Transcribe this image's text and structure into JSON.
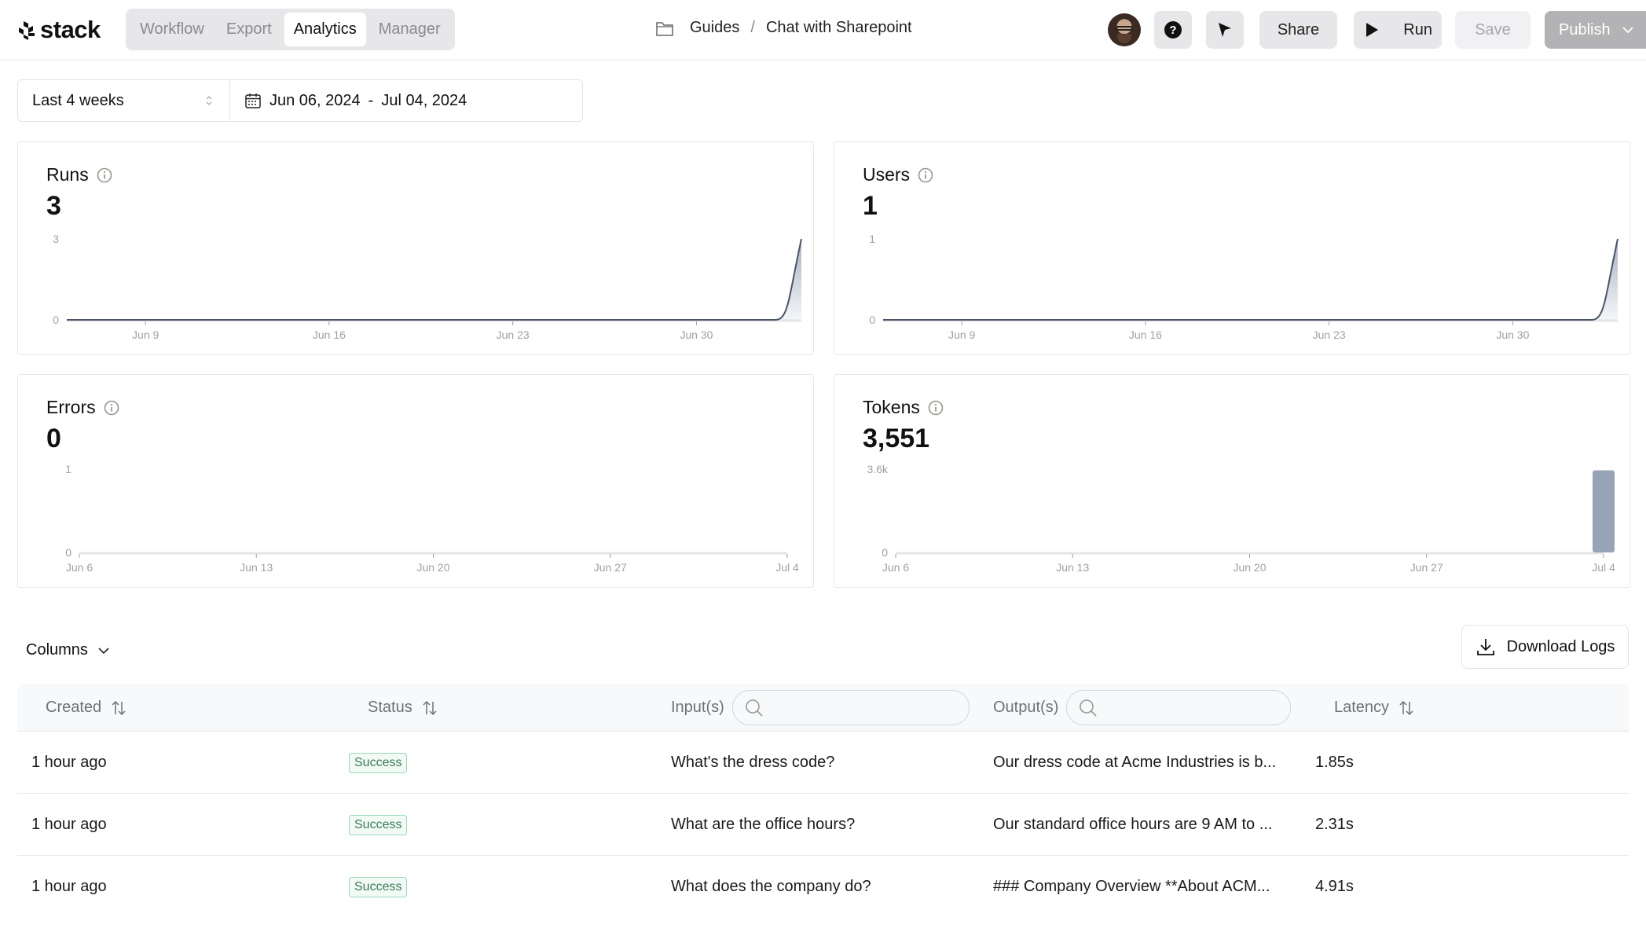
{
  "app": {
    "logo_text": "stack",
    "tabs": [
      {
        "label": "Workflow",
        "active": false
      },
      {
        "label": "Export",
        "active": false
      },
      {
        "label": "Analytics",
        "active": true
      },
      {
        "label": "Manager",
        "active": false
      }
    ],
    "breadcrumb": {
      "icon": "folder-icon",
      "parent": "Guides",
      "separator": "/",
      "current": "Chat with Sharepoint"
    },
    "toolbar": {
      "help_icon": "question-circle-icon",
      "pointer_icon": "cursor-arrow-icon",
      "share_label": "Share",
      "run_label": "Run",
      "save_label": "Save",
      "publish_label": "Publish"
    }
  },
  "filters": {
    "range_label": "Last 4 weeks",
    "date_start": "Jun 06, 2024",
    "date_sep": "-",
    "date_end": "Jul 04, 2024"
  },
  "metrics": {
    "runs": {
      "title": "Runs",
      "value": "3"
    },
    "users": {
      "title": "Users",
      "value": "1"
    },
    "errors": {
      "title": "Errors",
      "value": "0"
    },
    "tokens": {
      "title": "Tokens",
      "value": "3,551"
    }
  },
  "chart_data": [
    {
      "id": "runs",
      "type": "area",
      "title": "Runs",
      "x": [
        "Jun 6",
        "Jun 7",
        "Jun 8",
        "Jun 9",
        "Jun 10",
        "Jun 11",
        "Jun 12",
        "Jun 13",
        "Jun 14",
        "Jun 15",
        "Jun 16",
        "Jun 17",
        "Jun 18",
        "Jun 19",
        "Jun 20",
        "Jun 21",
        "Jun 22",
        "Jun 23",
        "Jun 24",
        "Jun 25",
        "Jun 26",
        "Jun 27",
        "Jun 28",
        "Jun 29",
        "Jun 30",
        "Jul 1",
        "Jul 2",
        "Jul 3",
        "Jul 4"
      ],
      "values": [
        0,
        0,
        0,
        0,
        0,
        0,
        0,
        0,
        0,
        0,
        0,
        0,
        0,
        0,
        0,
        0,
        0,
        0,
        0,
        0,
        0,
        0,
        0,
        0,
        0,
        0,
        0,
        0,
        3
      ],
      "ylim": [
        0,
        3
      ],
      "y_ticks": [
        "0",
        "3"
      ],
      "x_ticks": [
        "Jun 9",
        "Jun 16",
        "Jun 23",
        "Jun 30"
      ],
      "grid": false
    },
    {
      "id": "users",
      "type": "area",
      "title": "Users",
      "x": [
        "Jun 6",
        "Jun 7",
        "Jun 8",
        "Jun 9",
        "Jun 10",
        "Jun 11",
        "Jun 12",
        "Jun 13",
        "Jun 14",
        "Jun 15",
        "Jun 16",
        "Jun 17",
        "Jun 18",
        "Jun 19",
        "Jun 20",
        "Jun 21",
        "Jun 22",
        "Jun 23",
        "Jun 24",
        "Jun 25",
        "Jun 26",
        "Jun 27",
        "Jun 28",
        "Jun 29",
        "Jun 30",
        "Jul 1",
        "Jul 2",
        "Jul 3",
        "Jul 4"
      ],
      "values": [
        0,
        0,
        0,
        0,
        0,
        0,
        0,
        0,
        0,
        0,
        0,
        0,
        0,
        0,
        0,
        0,
        0,
        0,
        0,
        0,
        0,
        0,
        0,
        0,
        0,
        0,
        0,
        0,
        1
      ],
      "ylim": [
        0,
        1
      ],
      "y_ticks": [
        "0",
        "1"
      ],
      "x_ticks": [
        "Jun 9",
        "Jun 16",
        "Jun 23",
        "Jun 30"
      ],
      "grid": false
    },
    {
      "id": "errors",
      "type": "bar",
      "title": "Errors",
      "x": [
        "Jun 6",
        "Jun 7",
        "Jun 8",
        "Jun 9",
        "Jun 10",
        "Jun 11",
        "Jun 12",
        "Jun 13",
        "Jun 14",
        "Jun 15",
        "Jun 16",
        "Jun 17",
        "Jun 18",
        "Jun 19",
        "Jun 20",
        "Jun 21",
        "Jun 22",
        "Jun 23",
        "Jun 24",
        "Jun 25",
        "Jun 26",
        "Jun 27",
        "Jun 28",
        "Jun 29",
        "Jun 30",
        "Jul 1",
        "Jul 2",
        "Jul 3",
        "Jul 4"
      ],
      "values": [
        0,
        0,
        0,
        0,
        0,
        0,
        0,
        0,
        0,
        0,
        0,
        0,
        0,
        0,
        0,
        0,
        0,
        0,
        0,
        0,
        0,
        0,
        0,
        0,
        0,
        0,
        0,
        0,
        0
      ],
      "ylim": [
        0,
        1
      ],
      "y_ticks": [
        "0",
        "1"
      ],
      "x_ticks": [
        "Jun 6",
        "Jun 13",
        "Jun 20",
        "Jun 27",
        "Jul 4"
      ],
      "grid": false
    },
    {
      "id": "tokens",
      "type": "bar",
      "title": "Tokens",
      "x": [
        "Jun 6",
        "Jun 7",
        "Jun 8",
        "Jun 9",
        "Jun 10",
        "Jun 11",
        "Jun 12",
        "Jun 13",
        "Jun 14",
        "Jun 15",
        "Jun 16",
        "Jun 17",
        "Jun 18",
        "Jun 19",
        "Jun 20",
        "Jun 21",
        "Jun 22",
        "Jun 23",
        "Jun 24",
        "Jun 25",
        "Jun 26",
        "Jun 27",
        "Jun 28",
        "Jun 29",
        "Jun 30",
        "Jul 1",
        "Jul 2",
        "Jul 3",
        "Jul 4"
      ],
      "values": [
        0,
        0,
        0,
        0,
        0,
        0,
        0,
        0,
        0,
        0,
        0,
        0,
        0,
        0,
        0,
        0,
        0,
        0,
        0,
        0,
        0,
        0,
        0,
        0,
        0,
        0,
        0,
        0,
        3551
      ],
      "ylim": [
        0,
        3600
      ],
      "y_ticks": [
        "0",
        "3.6k"
      ],
      "x_ticks": [
        "Jun 6",
        "Jun 13",
        "Jun 20",
        "Jun 27",
        "Jul 4"
      ],
      "grid": false
    }
  ],
  "table": {
    "columns_label": "Columns",
    "download_label": "Download Logs",
    "headers": {
      "created": "Created",
      "status": "Status",
      "inputs": "Input(s)",
      "outputs": "Output(s)",
      "latency": "Latency"
    },
    "inputs_search_placeholder": "",
    "outputs_search_placeholder": "",
    "rows": [
      {
        "created": "1 hour ago",
        "status": "Success",
        "input": "What's the dress code?",
        "output": "Our dress code at Acme Industries is b...",
        "latency": "1.85s"
      },
      {
        "created": "1 hour ago",
        "status": "Success",
        "input": "What are the office hours?",
        "output": "Our standard office hours are 9 AM to ...",
        "latency": "2.31s"
      },
      {
        "created": "1 hour ago",
        "status": "Success",
        "input": "What does the company do?",
        "output": "### Company Overview **About ACM...",
        "latency": "4.91s"
      }
    ]
  },
  "colors": {
    "series_line": "#4b5565",
    "series_fill": "#97a3b6",
    "axis": "#e4e5e9",
    "success_text": "#3b7a57",
    "success_border": "#9bd8b8"
  }
}
